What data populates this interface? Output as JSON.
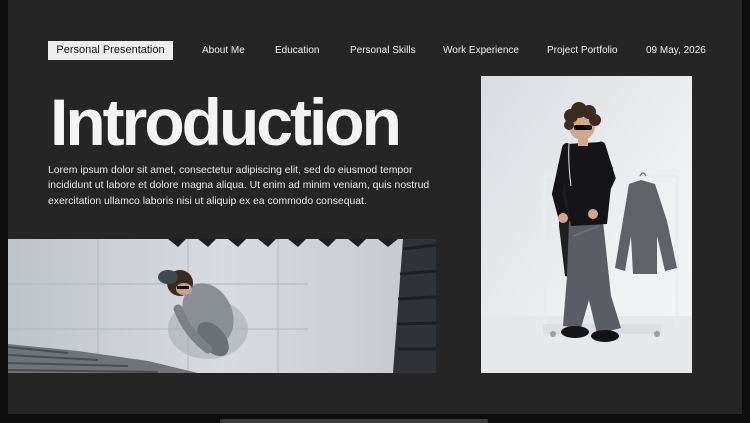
{
  "nav": {
    "brand": "Personal Presentation",
    "items": [
      {
        "label": "About Me"
      },
      {
        "label": "Education"
      },
      {
        "label": "Personal Skills"
      },
      {
        "label": "Work Experience"
      },
      {
        "label": "Project Portfolio"
      }
    ],
    "date": "09 May, 2026"
  },
  "main": {
    "title": "Introduction",
    "body": "Lorem ipsum dolor sit amet, consectetur adipiscing elit, sed do eiusmod tempor incididunt ut labore et dolore magna aliqua. Ut enim ad minim veniam, quis nostrud exercitation ullamco laboris nisi ut aliquip ex ea commodo consequat."
  },
  "colors": {
    "background": "#252525",
    "brand_pill": "#eeeeee",
    "text": "#ffffff"
  }
}
